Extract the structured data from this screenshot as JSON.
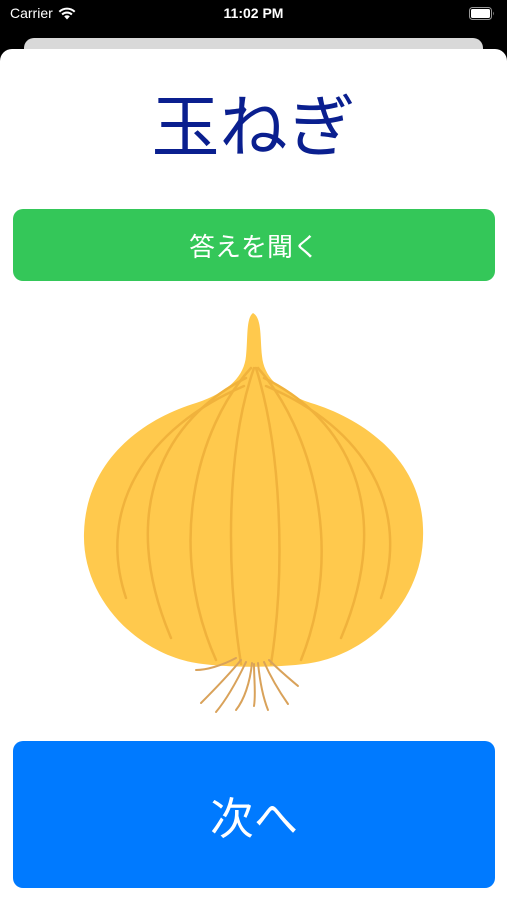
{
  "status_bar": {
    "carrier": "Carrier",
    "time": "11:02 PM",
    "wifi_icon": "wifi-icon",
    "battery_icon": "battery-icon"
  },
  "card": {
    "word": "玉ねぎ",
    "image_icon": "onion-illustration"
  },
  "buttons": {
    "answer_label": "答えを聞く",
    "next_label": "次へ"
  },
  "colors": {
    "title": "#0a1f8f",
    "answer_button": "#34c759",
    "next_button": "#007aff",
    "onion_body": "#ffc94d"
  }
}
